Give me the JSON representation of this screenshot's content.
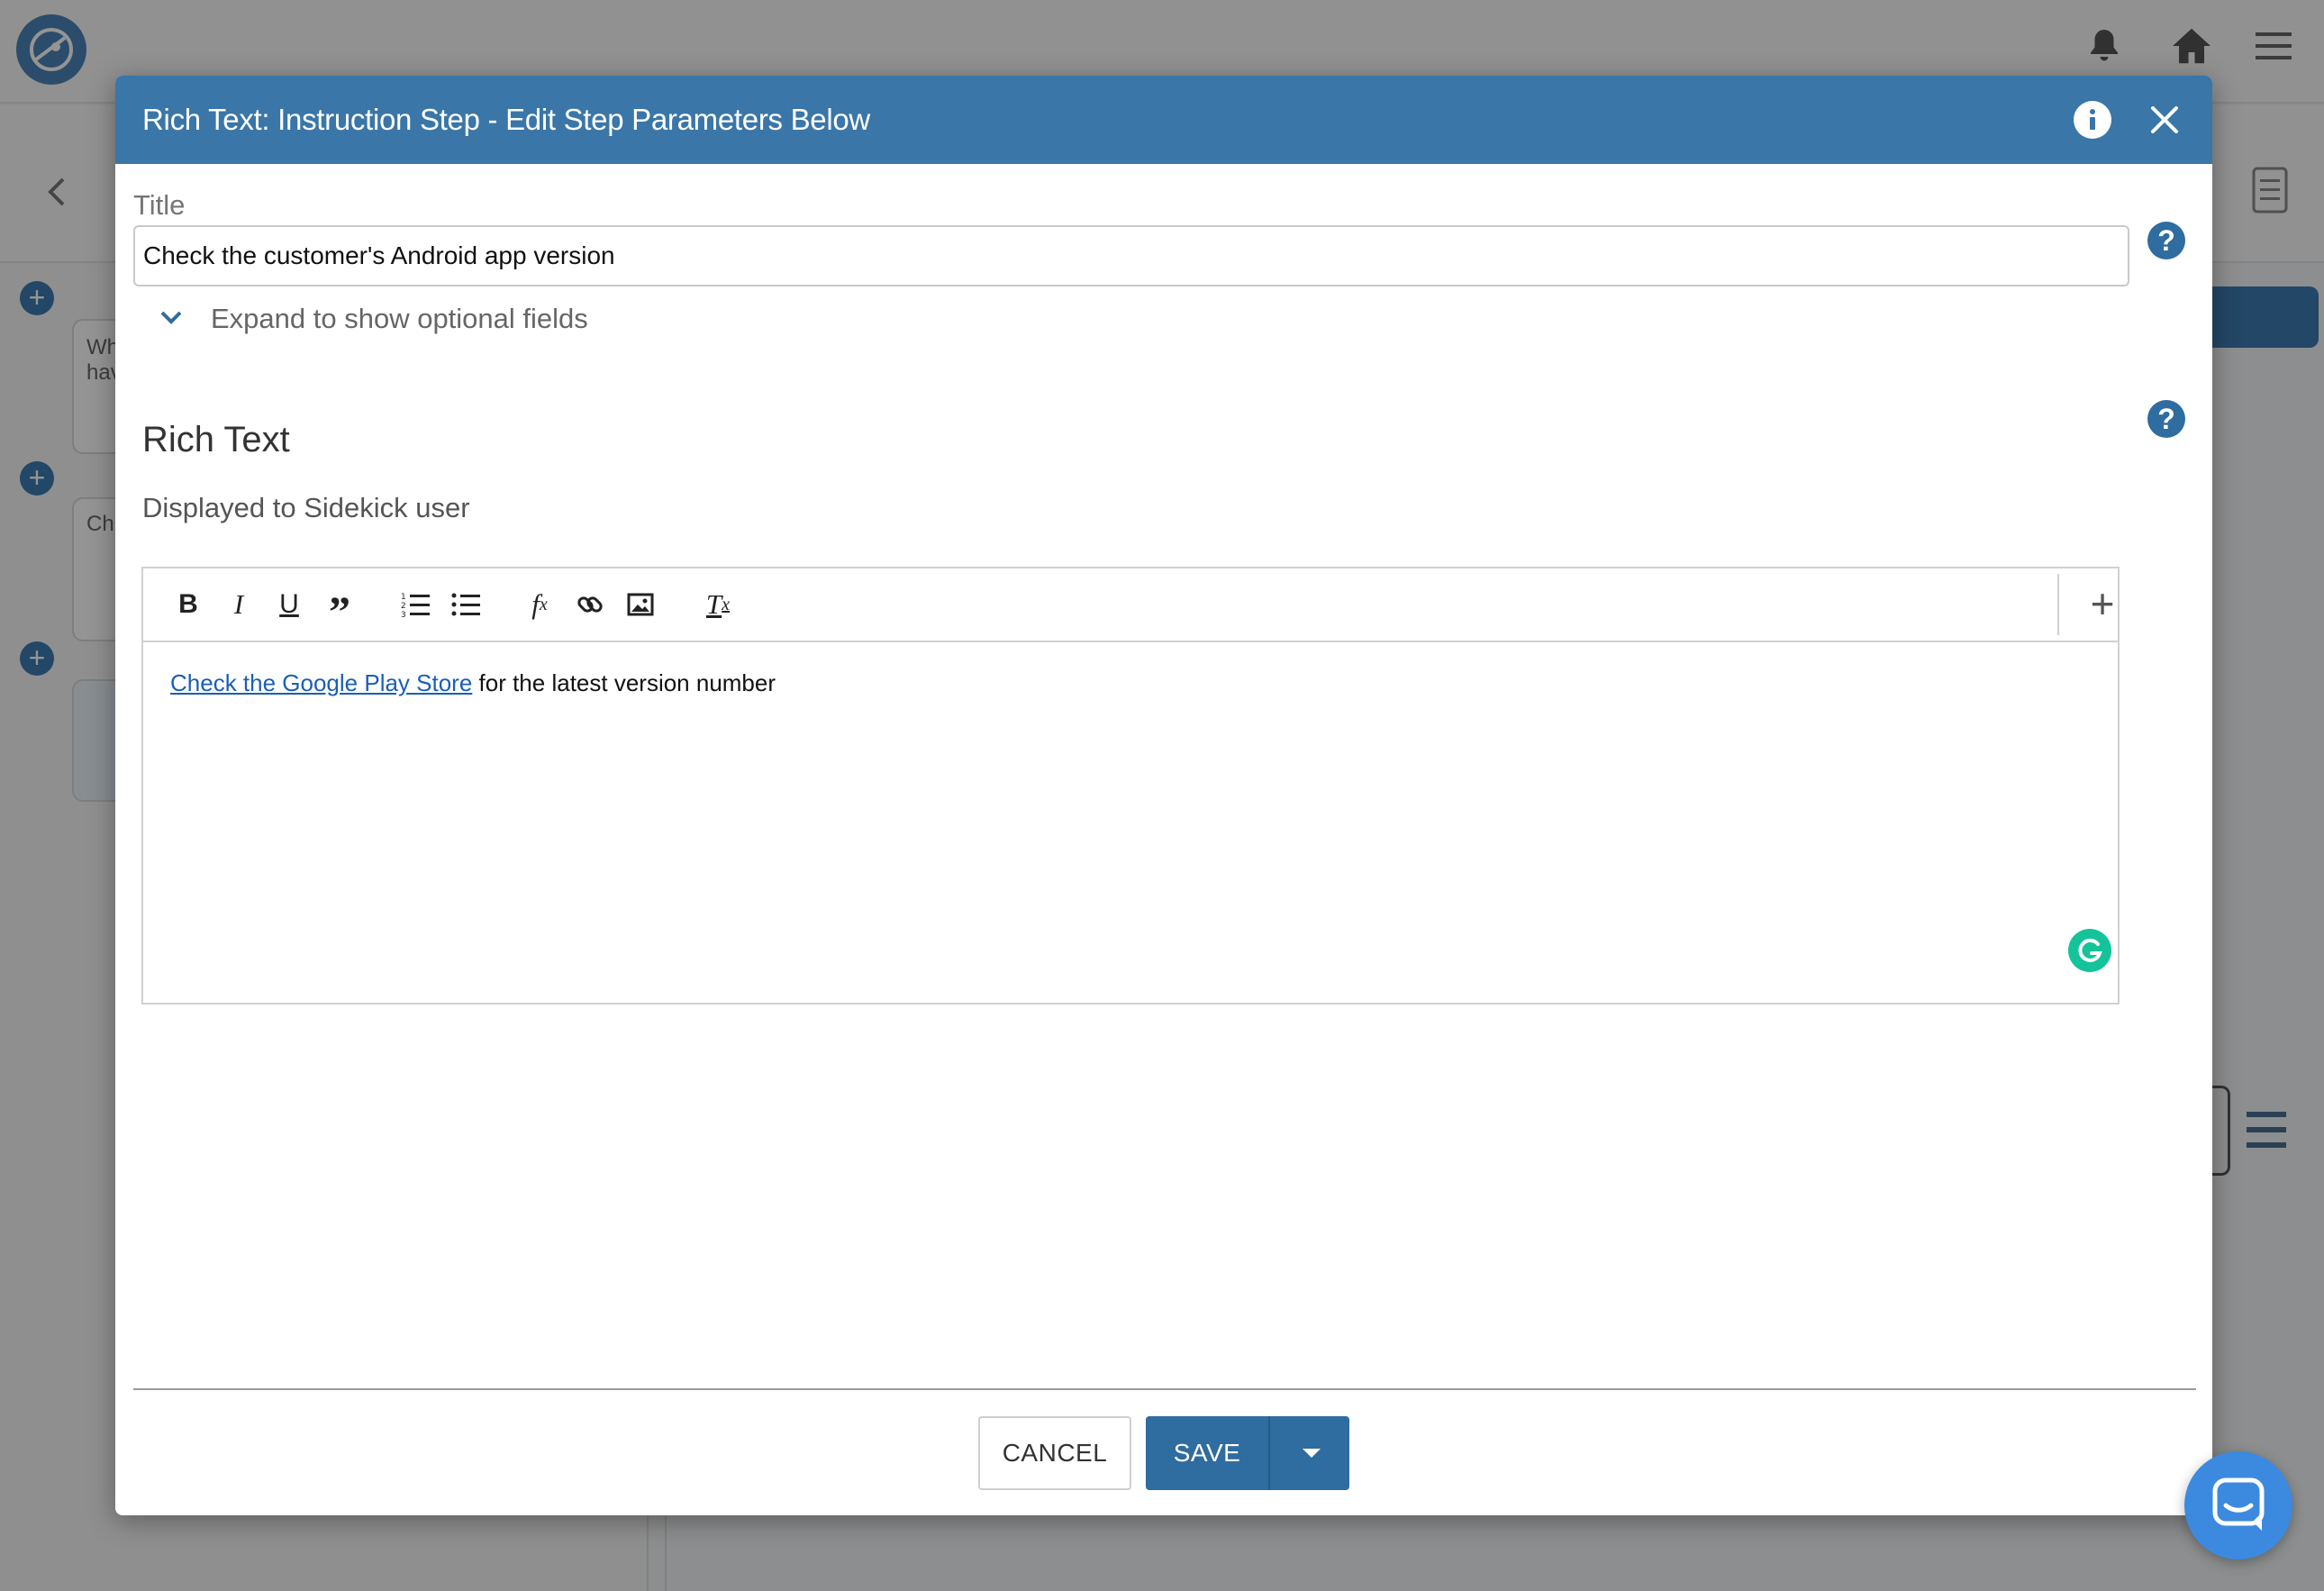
{
  "dialog": {
    "title": "Rich Text: Instruction Step - Edit Step Parameters Below"
  },
  "form": {
    "title_label": "Title",
    "title_value": "Check the customer's Android app version",
    "expand_label": "Expand to show optional fields",
    "rich_text_heading": "Rich Text",
    "rich_text_subtitle": "Displayed to Sidekick user"
  },
  "editor": {
    "link_text": "Check the Google Play Store",
    "body_text": " for the latest version number",
    "toolbar": [
      "bold-icon",
      "italic-icon",
      "underline-icon",
      "blockquote-icon",
      "numbered-list-icon",
      "bulleted-list-icon",
      "formula-icon",
      "link-icon",
      "image-icon",
      "clear-format-icon",
      "plus-icon"
    ]
  },
  "footer": {
    "cancel_label": "CANCEL",
    "save_label": "SAVE"
  },
  "background": {
    "card1_line1": "Wh",
    "card1_line2": "hav",
    "card2_text": "Ch"
  },
  "colors": {
    "header_blue": "#3a76a8",
    "primary_button": "#2f6c9f",
    "link": "#1a5fb4",
    "grammarly": "#15c39a"
  }
}
